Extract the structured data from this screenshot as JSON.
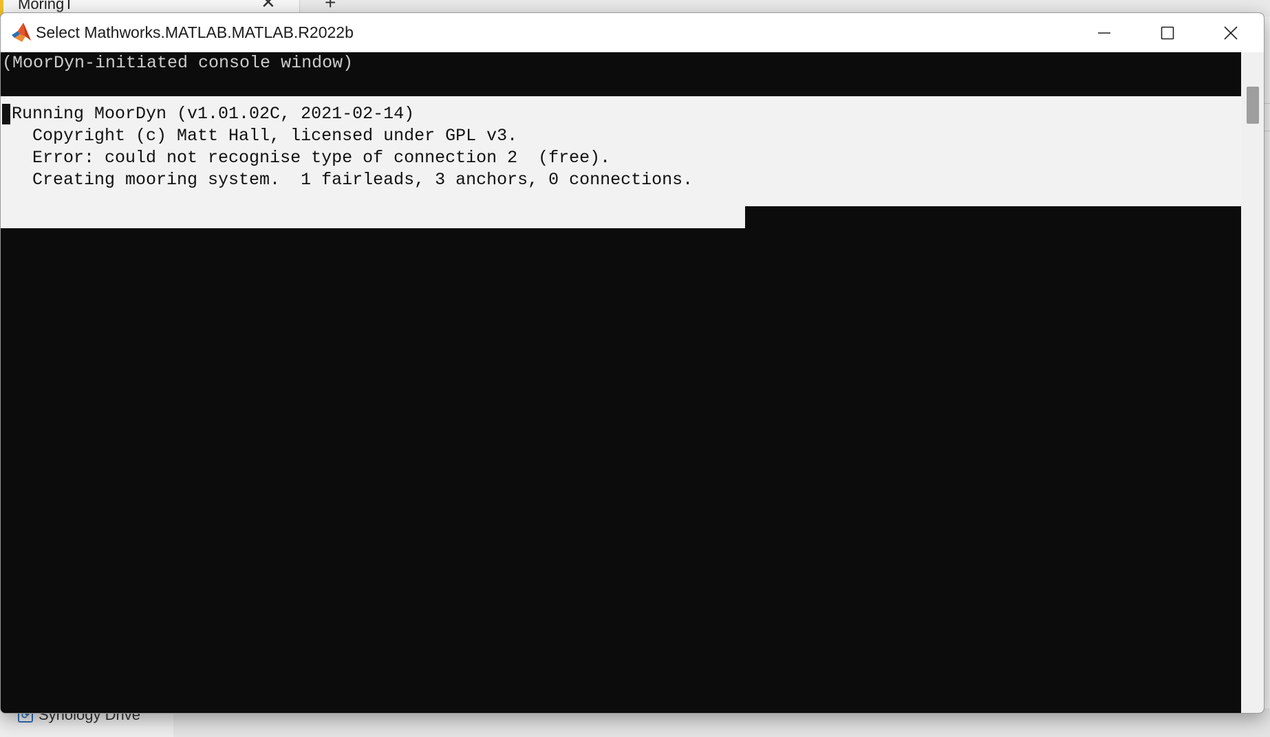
{
  "background": {
    "tab_title": "MoringT",
    "tab_close_glyph": "✕",
    "new_tab_glyph": "+",
    "sidebar_item_label": "Synology Drive",
    "drive_icon_glyph": "⟳"
  },
  "window": {
    "title": "Select Mathworks.MATLAB.MATLAB.R2022b",
    "app_icon": "matlab-icon",
    "colors": {
      "console_bg": "#0c0c0c",
      "console_text": "#cccccc",
      "selection_bg": "#f2f2f2",
      "selection_text": "#111111"
    }
  },
  "console": {
    "header_line": "(MoorDyn-initiated console window)",
    "lines": [
      "Running MoorDyn (v1.01.02C, 2021-02-14)",
      "  Copyright (c) Matt Hall, licensed under GPL v3.",
      "  Error: could not recognise type of connection 2  (free).",
      "  Creating mooring system.  1 fairleads, 3 anchors, 0 connections."
    ]
  }
}
